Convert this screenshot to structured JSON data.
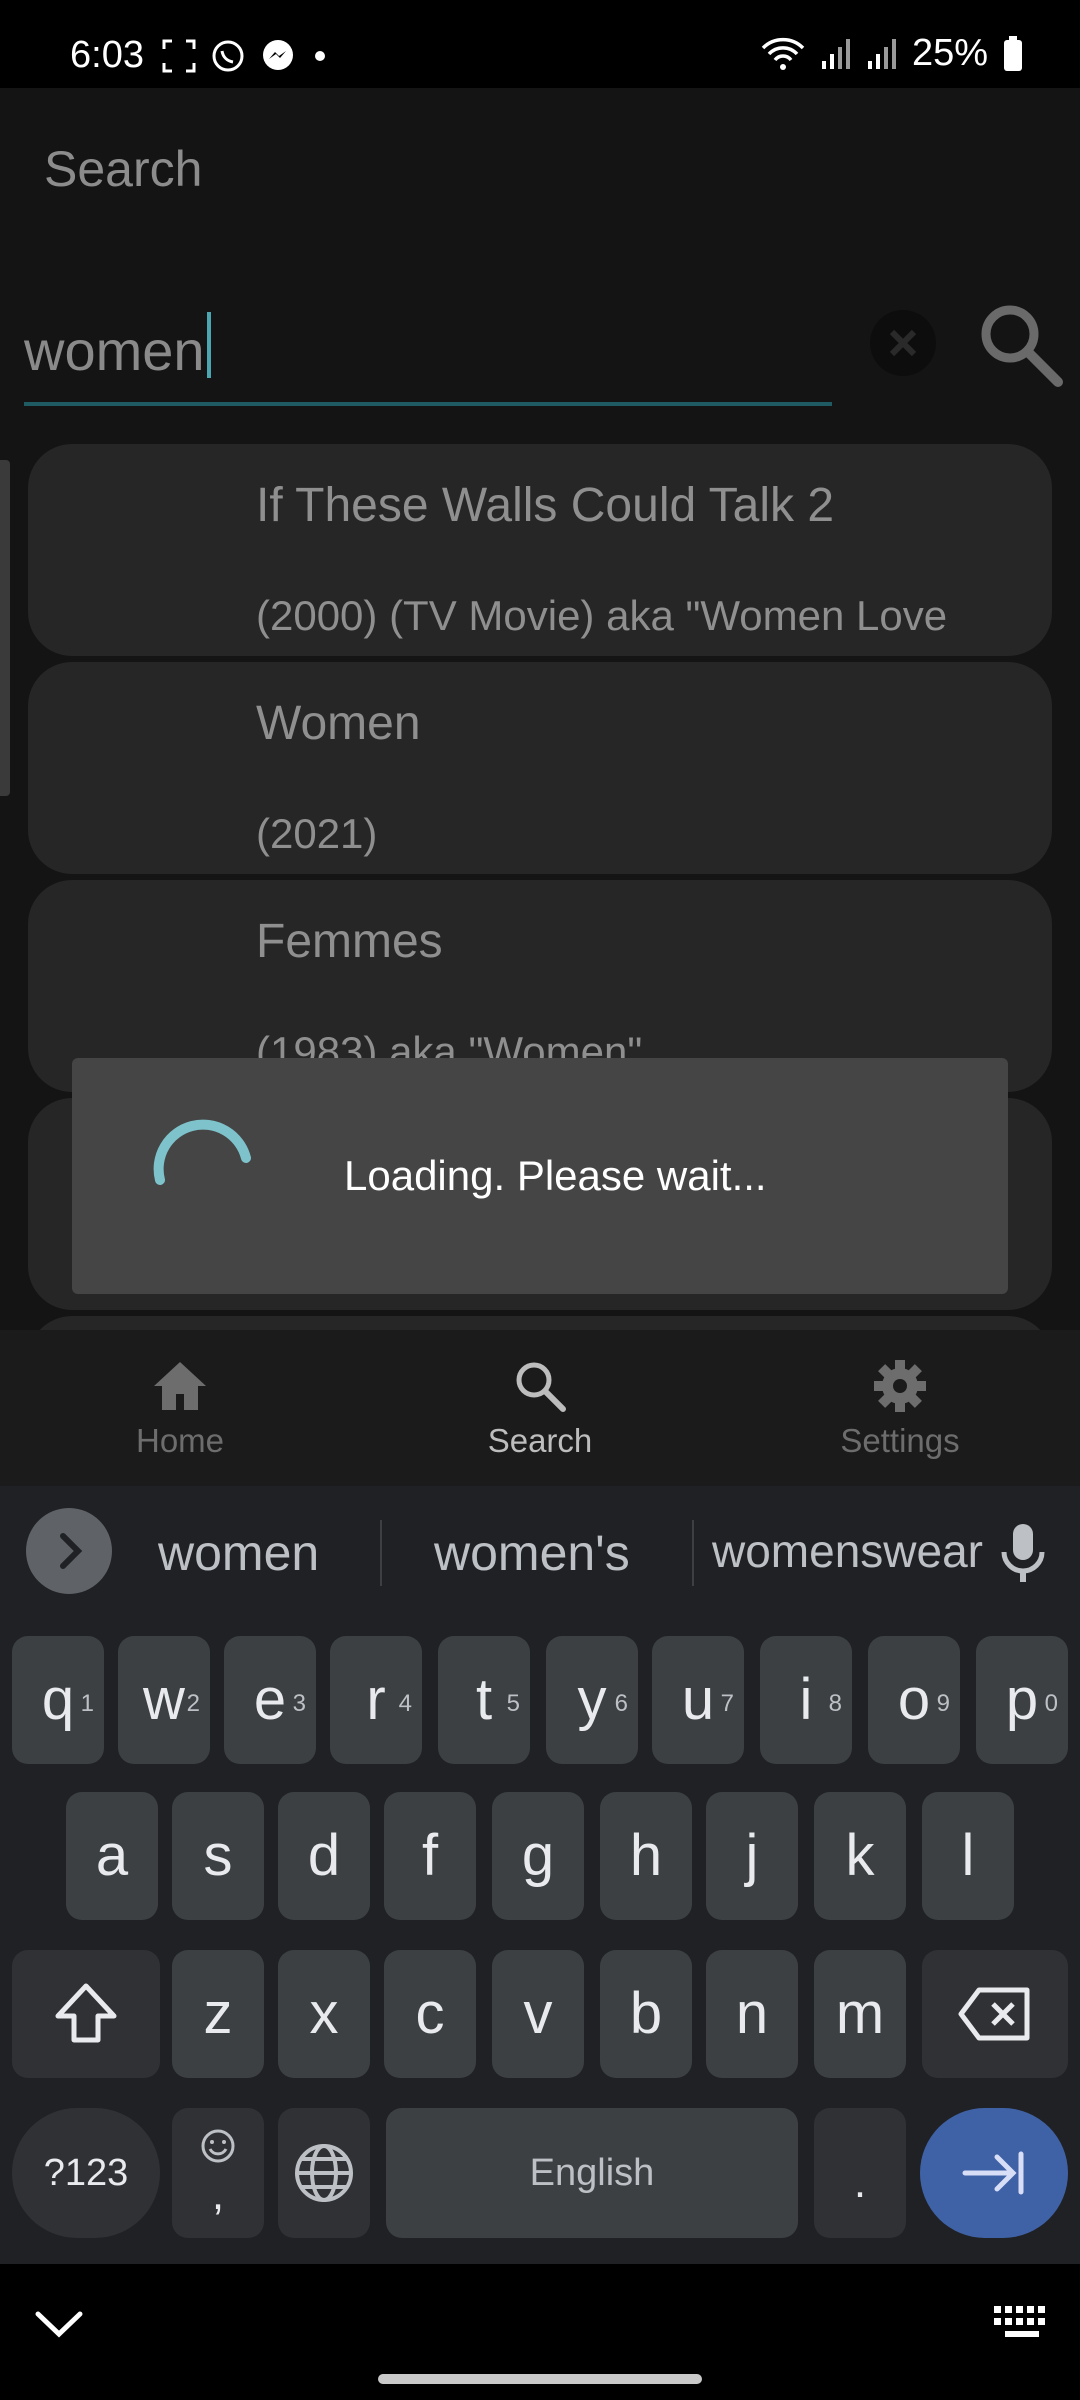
{
  "status_bar": {
    "time": "6:03",
    "battery": "25%"
  },
  "app": {
    "title": "Search",
    "search": {
      "value": "women"
    }
  },
  "results": [
    {
      "title": "If These Walls Could Talk 2",
      "subtitle": "(2000) (TV Movie) aka \"Women Love"
    },
    {
      "title": "Women",
      "subtitle": "(2021)"
    },
    {
      "title": "Femmes",
      "subtitle": "(1983) aka \"Women\""
    },
    {
      "title": "",
      "subtitle": ""
    }
  ],
  "loading_dialog": {
    "message": "Loading. Please wait..."
  },
  "bottom_nav": {
    "items": [
      {
        "label": "Home",
        "icon": "home-icon",
        "active": false
      },
      {
        "label": "Search",
        "icon": "search-icon",
        "active": true
      },
      {
        "label": "Settings",
        "icon": "gear-icon",
        "active": false
      }
    ]
  },
  "keyboard": {
    "suggestions": [
      "women",
      "women's",
      "womenswear"
    ],
    "row1": [
      [
        "q",
        "1"
      ],
      [
        "w",
        "2"
      ],
      [
        "e",
        "3"
      ],
      [
        "r",
        "4"
      ],
      [
        "t",
        "5"
      ],
      [
        "y",
        "6"
      ],
      [
        "u",
        "7"
      ],
      [
        "i",
        "8"
      ],
      [
        "o",
        "9"
      ],
      [
        "p",
        "0"
      ]
    ],
    "row2": [
      "a",
      "s",
      "d",
      "f",
      "g",
      "h",
      "j",
      "k",
      "l"
    ],
    "row3": [
      "z",
      "x",
      "c",
      "v",
      "b",
      "n",
      "m"
    ],
    "symbols_label": "?123",
    "comma": ",",
    "space_label": "English",
    "period": "."
  },
  "colors": {
    "accent": "#4ba6b0",
    "enter_key": "#3f62a7",
    "card": "#262626",
    "dialog": "#454545"
  }
}
